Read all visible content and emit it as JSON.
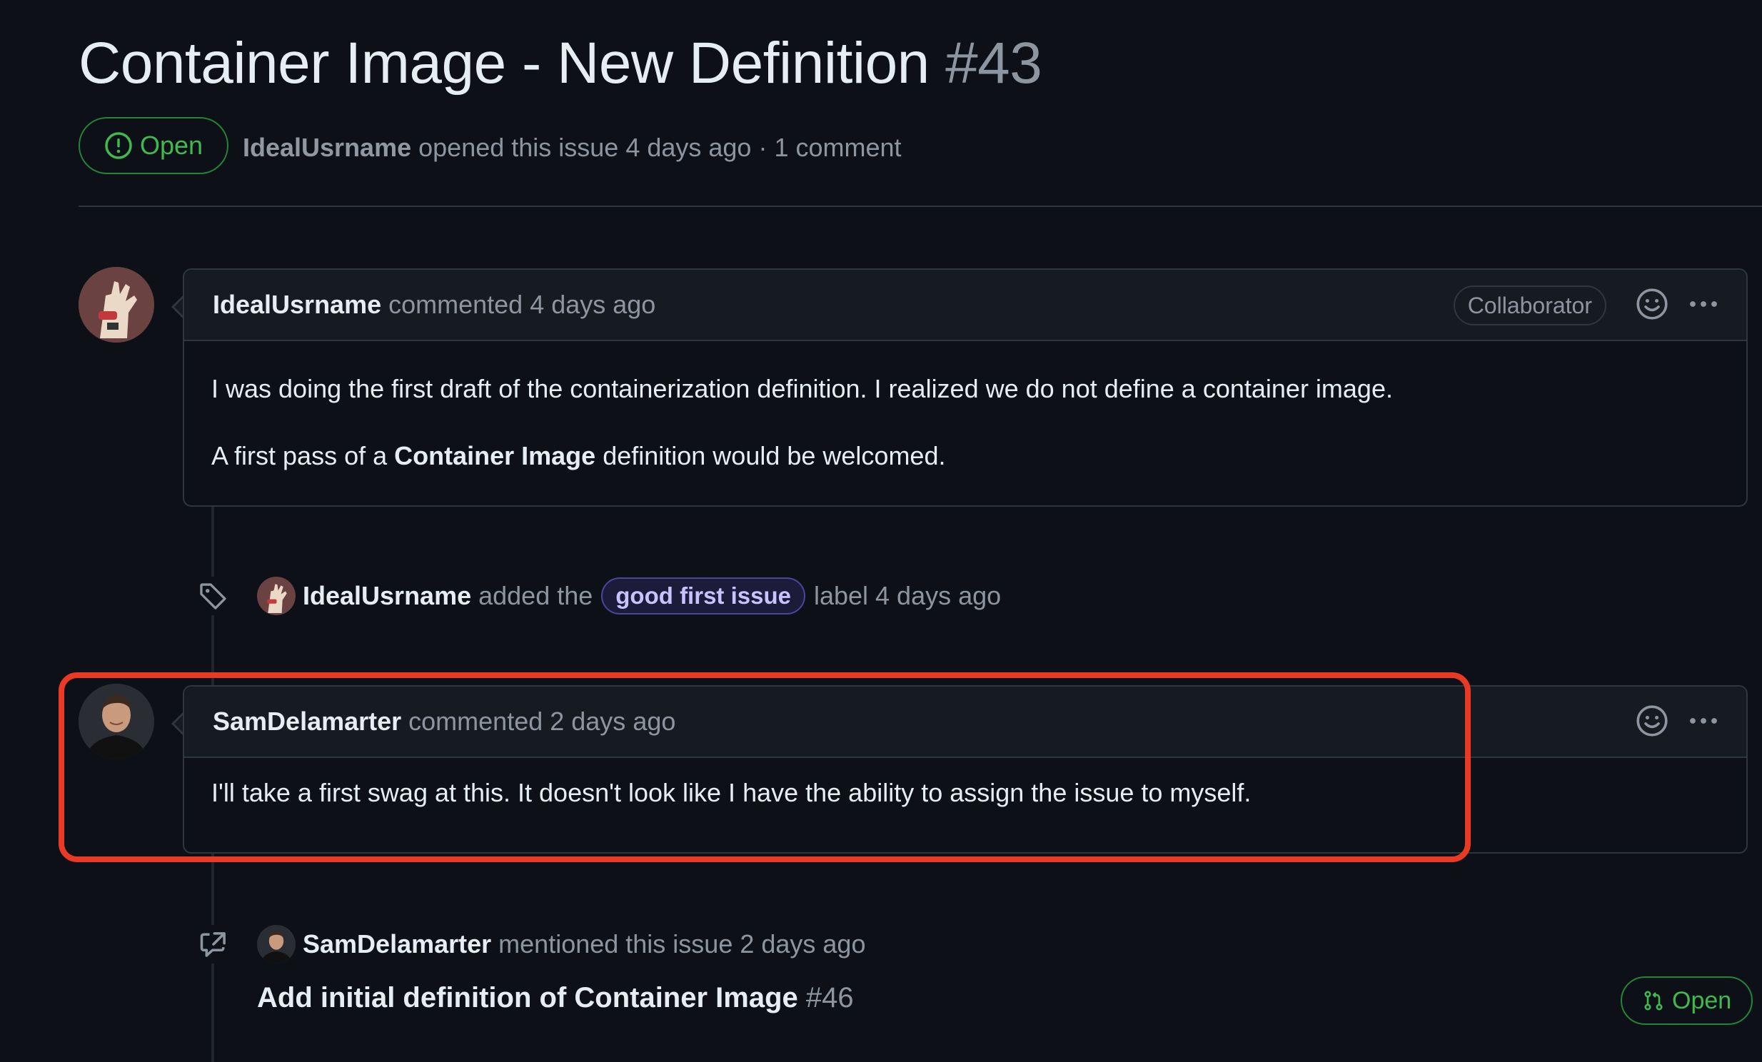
{
  "issue": {
    "title": "Container Image - New Definition",
    "number": "#43",
    "state": "Open",
    "author": "IdealUsrname",
    "opened_text": "opened this issue 4 days ago · 1 comment"
  },
  "comments": [
    {
      "author": "IdealUsrname",
      "meta": "commented 4 days ago",
      "role": "Collaborator",
      "paragraph1": "I was doing the first draft of the containerization definition. I realized we do not define a container image.",
      "paragraph2_before": "A first pass of a ",
      "paragraph2_bold": "Container Image",
      "paragraph2_after": " definition would be welcomed."
    },
    {
      "author": "SamDelamarter",
      "meta": "commented 2 days ago",
      "text": "I'll take a first swag at this. It doesn't look like I have the ability to assign the issue to myself."
    }
  ],
  "label_event": {
    "actor": "IdealUsrname",
    "action": "added the",
    "label": "good first issue",
    "suffix": "label 4 days ago"
  },
  "mention_event": {
    "actor": "SamDelamarter",
    "action": "mentioned this issue 2 days ago",
    "pr_title": "Add initial definition of Container Image",
    "pr_number": "#46",
    "pr_state": "Open"
  },
  "colors": {
    "open_green": "#3fb950",
    "highlight_red": "#ea3a25",
    "label_purple": "#c8c2ff"
  },
  "icons": [
    "issue-opened-icon",
    "smiley-icon",
    "kebab-horizontal-icon",
    "tag-icon",
    "cross-reference-icon",
    "pull-request-icon"
  ]
}
